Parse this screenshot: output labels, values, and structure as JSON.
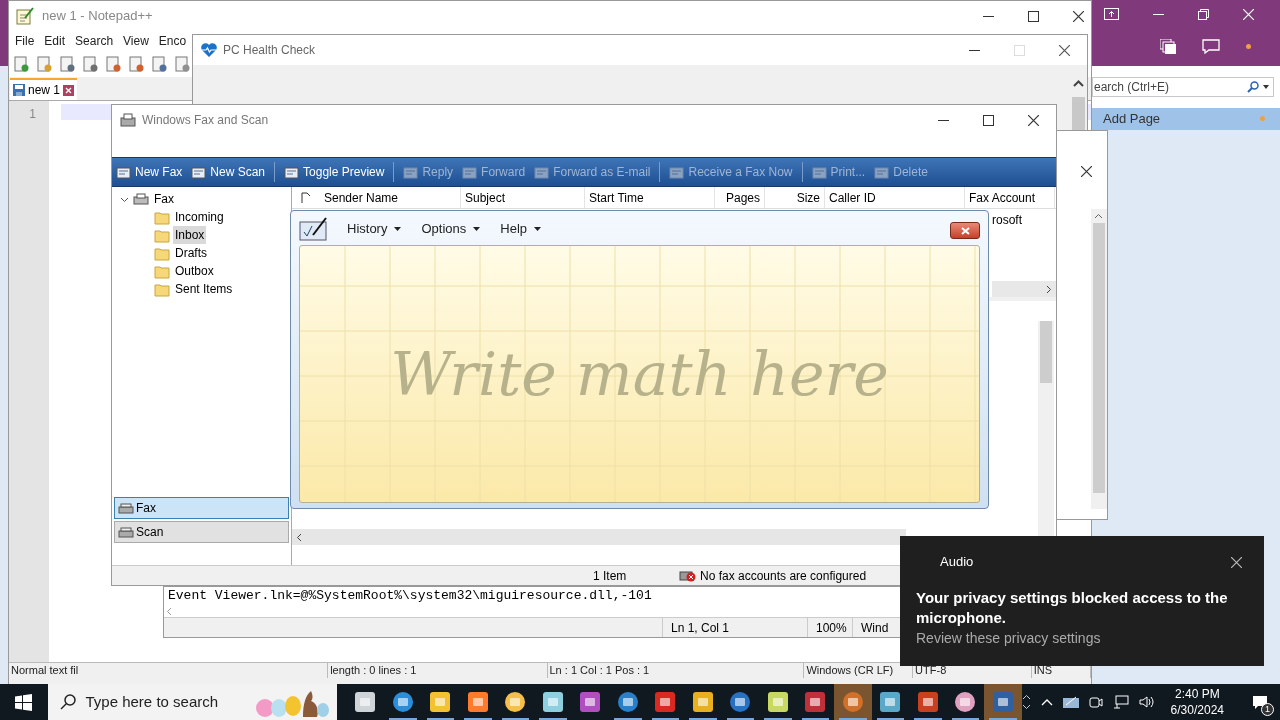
{
  "onenote": {
    "search": {
      "placeholder": "earch (Ctrl+E)"
    },
    "add_page": "Add Page"
  },
  "notepadpp": {
    "title": "new 1 - Notepad++",
    "menu": [
      "File",
      "Edit",
      "Search",
      "View",
      "Enco"
    ],
    "tabs": [
      {
        "label": "new 1",
        "selected": true
      }
    ],
    "line_numbers": [
      "1"
    ],
    "status_bar": [
      "Normal text fil",
      "length : 0    lines : 1",
      "Ln : 1    Col : 1    Pos : 1",
      "Windows (CR LF)",
      "UTF-8",
      "INS"
    ]
  },
  "pc_health_check": {
    "title": "PC Health Check"
  },
  "notepad": {
    "text": "Event Viewer.lnk=@%SystemRoot%\\system32\\miguiresource.dll,-101",
    "status_bar": [
      "Ln 1, Col 1",
      "100%",
      "Wind"
    ]
  },
  "fax_and_scan": {
    "title": "Windows Fax and Scan",
    "toolbar": [
      {
        "label": "New Fax",
        "disabled": false
      },
      {
        "label": "New Scan",
        "disabled": false
      },
      {
        "label": "Toggle Preview",
        "disabled": false
      },
      {
        "label": "Reply",
        "disabled": true
      },
      {
        "label": "Forward",
        "disabled": true
      },
      {
        "label": "Forward as E-mail",
        "disabled": true
      },
      {
        "label": "Receive a Fax Now",
        "disabled": true
      },
      {
        "label": "Print...",
        "disabled": true
      },
      {
        "label": "Delete",
        "disabled": true
      }
    ],
    "tree": [
      {
        "label": "Fax",
        "expanded": true,
        "selected": false,
        "children": [
          {
            "label": "Incoming",
            "selected": false
          },
          {
            "label": "Inbox",
            "selected": true
          },
          {
            "label": "Drafts",
            "selected": false
          },
          {
            "label": "Outbox",
            "selected": false
          },
          {
            "label": "Sent Items",
            "selected": false
          }
        ]
      }
    ],
    "table": {
      "columns": [
        "Sender Name",
        "Subject",
        "Start Time",
        "Pages",
        "Size",
        "Caller ID",
        "Fax Account"
      ],
      "rows": [
        {
          "fax_account": "rosoft"
        }
      ]
    },
    "nav": [
      {
        "label": "Fax",
        "selected": true
      },
      {
        "label": "Scan",
        "selected": false
      }
    ],
    "status_bar": [
      "1 Item",
      "No fax accounts are configured"
    ]
  },
  "math_input_panel": {
    "menu": [
      "History",
      "Options",
      "Help"
    ],
    "placeholder": "Write math here"
  },
  "notification": {
    "app": "Audio",
    "title": "Your privacy settings blocked access to the microphone.",
    "body": "Review these privacy settings"
  },
  "taskbar": {
    "search": {
      "placeholder": "Type here to search"
    },
    "time": "2:40 PM",
    "date": "6/30/2024",
    "notification_count": "1"
  }
}
